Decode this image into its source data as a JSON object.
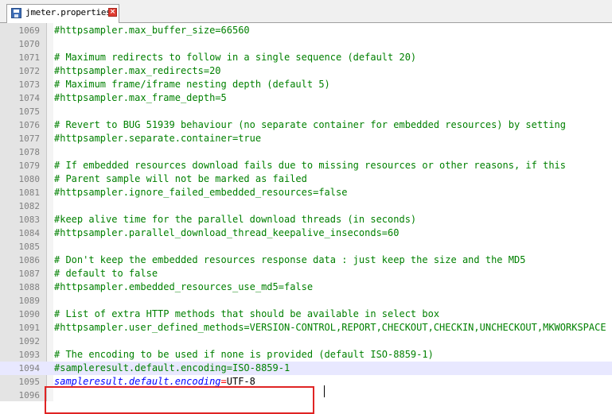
{
  "tab": {
    "label": "jmeter.properties"
  },
  "lines": [
    {
      "num": "1069",
      "text": "#httpsampler.max_buffer_size=66560"
    },
    {
      "num": "1070",
      "text": ""
    },
    {
      "num": "1071",
      "text": "# Maximum redirects to follow in a single sequence (default 20)"
    },
    {
      "num": "1072",
      "text": "#httpsampler.max_redirects=20"
    },
    {
      "num": "1073",
      "text": "# Maximum frame/iframe nesting depth (default 5)"
    },
    {
      "num": "1074",
      "text": "#httpsampler.max_frame_depth=5"
    },
    {
      "num": "1075",
      "text": ""
    },
    {
      "num": "1076",
      "text": "# Revert to BUG 51939 behaviour (no separate container for embedded resources) by setting"
    },
    {
      "num": "1077",
      "text": "#httpsampler.separate.container=true"
    },
    {
      "num": "1078",
      "text": ""
    },
    {
      "num": "1079",
      "text": "# If embedded resources download fails due to missing resources or other reasons, if this"
    },
    {
      "num": "1080",
      "text": "# Parent sample will not be marked as failed"
    },
    {
      "num": "1081",
      "text": "#httpsampler.ignore_failed_embedded_resources=false"
    },
    {
      "num": "1082",
      "text": ""
    },
    {
      "num": "1083",
      "text": "#keep alive time for the parallel download threads (in seconds)"
    },
    {
      "num": "1084",
      "text": "#httpsampler.parallel_download_thread_keepalive_inseconds=60"
    },
    {
      "num": "1085",
      "text": ""
    },
    {
      "num": "1086",
      "text": "# Don't keep the embedded resources response data : just keep the size and the MD5"
    },
    {
      "num": "1087",
      "text": "# default to false"
    },
    {
      "num": "1088",
      "text": "#httpsampler.embedded_resources_use_md5=false"
    },
    {
      "num": "1089",
      "text": ""
    },
    {
      "num": "1090",
      "text": "# List of extra HTTP methods that should be available in select box"
    },
    {
      "num": "1091",
      "text": "#httpsampler.user_defined_methods=VERSION-CONTROL,REPORT,CHECKOUT,CHECKIN,UNCHECKOUT,MKWORKSPACE"
    },
    {
      "num": "1092",
      "text": ""
    },
    {
      "num": "1093",
      "text": "# The encoding to be used if none is provided (default ISO-8859-1)"
    },
    {
      "num": "1094",
      "text": "#sampleresult.default.encoding=ISO-8859-1"
    },
    {
      "num": "1095",
      "key": "sampleresult.default.encoding",
      "eq": "=",
      "value": "UTF-8"
    },
    {
      "num": "1096",
      "text": ""
    }
  ],
  "current_line": "1094",
  "colors": {
    "comment": "#008000",
    "key": "#0000ff",
    "operator": "#ff0000",
    "value": "#000000",
    "highlight_box": "#e02424",
    "current_line_bg": "#e8e8ff"
  }
}
